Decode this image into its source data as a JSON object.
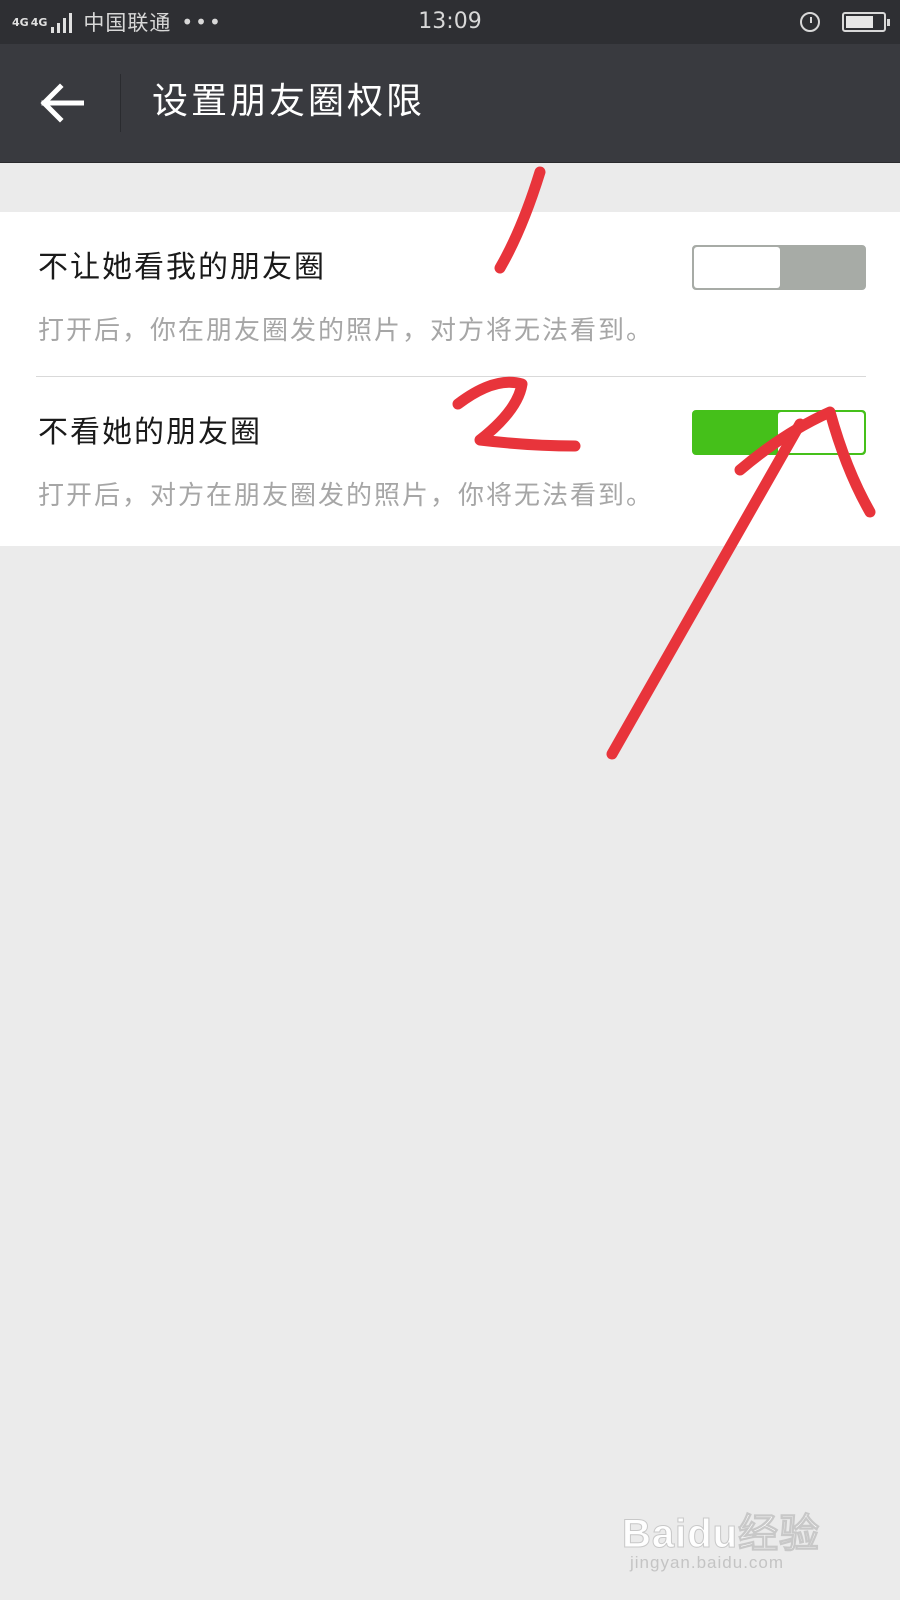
{
  "status_bar": {
    "network_1": "4G",
    "network_2": "4G",
    "carrier": "中国联通",
    "more": "•••",
    "time": "13:09",
    "icons": [
      "signal-icon",
      "alarm-icon",
      "battery-icon"
    ]
  },
  "nav": {
    "title": "设置朋友圈权限",
    "back_icon": "arrow-left-icon"
  },
  "settings": [
    {
      "title": "不让她看我的朋友圈",
      "description": "打开后，你在朋友圈发的照片，对方将无法看到。",
      "enabled": false
    },
    {
      "title": "不看她的朋友圈",
      "description": "打开后，对方在朋友圈发的照片，你将无法看到。",
      "enabled": true
    }
  ],
  "colors": {
    "switch_on": "#45c01a",
    "switch_off": "#a7aba6",
    "nav_bg": "#393a3f",
    "annotation": "#e8343b"
  },
  "watermark": {
    "brand": "Baidu经验",
    "url": "jingyan.baidu.com"
  }
}
